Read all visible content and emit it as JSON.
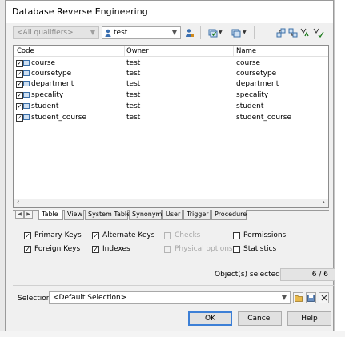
{
  "window": {
    "title": "Database Reverse Engineering"
  },
  "toolbar": {
    "qualifier_value": "<All qualifiers>",
    "owner_value": "test",
    "icons": [
      "owner-select-icon",
      "select-all-icon",
      "deselect-icon",
      "select-in-model-icon",
      "filter-icon",
      "filter-clear-icon"
    ]
  },
  "list": {
    "columns": [
      "Code",
      "Owner",
      "Name"
    ],
    "rows": [
      {
        "code": "course",
        "owner": "test",
        "name": "course",
        "checked": true
      },
      {
        "code": "coursetype",
        "owner": "test",
        "name": "coursetype",
        "checked": true
      },
      {
        "code": "department",
        "owner": "test",
        "name": "department",
        "checked": true
      },
      {
        "code": "specality",
        "owner": "test",
        "name": "specality",
        "checked": true
      },
      {
        "code": "student",
        "owner": "test",
        "name": "student",
        "checked": true
      },
      {
        "code": "student_course",
        "owner": "test",
        "name": "student_course",
        "checked": true
      }
    ]
  },
  "tabs": [
    "Table",
    "View",
    "System Table",
    "Synonym",
    "User",
    "Trigger",
    "Procedure"
  ],
  "tabs_active": "Table",
  "options": {
    "primary_keys": {
      "label": "Primary Keys",
      "checked": true,
      "enabled": true
    },
    "foreign_keys": {
      "label": "Foreign Keys",
      "checked": true,
      "enabled": true
    },
    "alternate_keys": {
      "label": "Alternate Keys",
      "checked": true,
      "enabled": true
    },
    "indexes": {
      "label": "Indexes",
      "checked": true,
      "enabled": true
    },
    "checks": {
      "label": "Checks",
      "checked": false,
      "enabled": false
    },
    "physical_options": {
      "label": "Physical options",
      "checked": false,
      "enabled": false
    },
    "permissions": {
      "label": "Permissions",
      "checked": false,
      "enabled": true
    },
    "statistics": {
      "label": "Statistics",
      "checked": false,
      "enabled": true
    }
  },
  "status": {
    "objects_selected_label": "Object(s) selected:",
    "objects_selected_value": "6 / 6"
  },
  "selection": {
    "label": "Selection:",
    "value": "<Default Selection>"
  },
  "buttons": {
    "ok": "OK",
    "cancel": "Cancel",
    "help": "Help"
  },
  "colors": {
    "accent": "#3c7fd6",
    "table_icon": "#3b6fa8"
  }
}
